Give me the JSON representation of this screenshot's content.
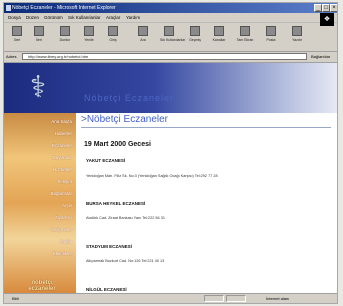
{
  "window": {
    "title": "Nöbetçi Eczaneler - Microsoft Internet Explorer",
    "min": "_",
    "max": "□",
    "close": "×"
  },
  "menu": [
    "Dosya",
    "Düzen",
    "Görünüm",
    "Sık Kullanılanlar",
    "Araçlar",
    "Yardım"
  ],
  "toolbar": {
    "buttons": [
      "Geri",
      "İleri",
      "Durdur",
      "Yenile",
      "Giriş",
      "Ara",
      "Sık Kullanılanlar",
      "Geçmiş",
      "Kanallar",
      "Tam Ekran",
      "Posta",
      "Yazdır"
    ]
  },
  "address": {
    "label": "Adres",
    "url": "http://www.tbmy.org.tr/nobetci.htm",
    "go_label": "Bağlantılar"
  },
  "page": {
    "banner_text": "Nöbetçi Eczaneler",
    "title": ">Nöbetçi Eczaneler",
    "date": "19 Mart 2000 Gecesi",
    "sidebar": [
      "Ana Sayfa",
      "Haberler",
      "Eczaneler",
      "Duyurular",
      "Hizmetler",
      "İletişim",
      "Bağlantılar",
      "Arşiv",
      "Ziyaretçi",
      "Gelişmeler",
      "Sağlık",
      "Etkinlikler"
    ],
    "sidebar_brand": "nöbetçi eczaneler",
    "pharmacies": [
      {
        "name": "YAKUT ECZANESİ",
        "address": "Yenidoğan Mah. Filiz Sk. No:3 (Yenidoğan Sağlık Ocağı Karşısı) Tel:292 77 28"
      },
      {
        "name": "BURSA HEYKEL ECZANESİ",
        "address": "Atatürk Cad. Ziraat Bankası Yanı Tel:222 56 31"
      },
      {
        "name": "STADYUM ECZANESİ",
        "address": "Altıparmak Bozkurt Cad. No:126 Tel:221 40 13"
      },
      {
        "name": "NİLGÜL ECZANESİ",
        "address": ""
      }
    ]
  },
  "status": {
    "left": "Bitti",
    "right": "İnternet alanı"
  }
}
